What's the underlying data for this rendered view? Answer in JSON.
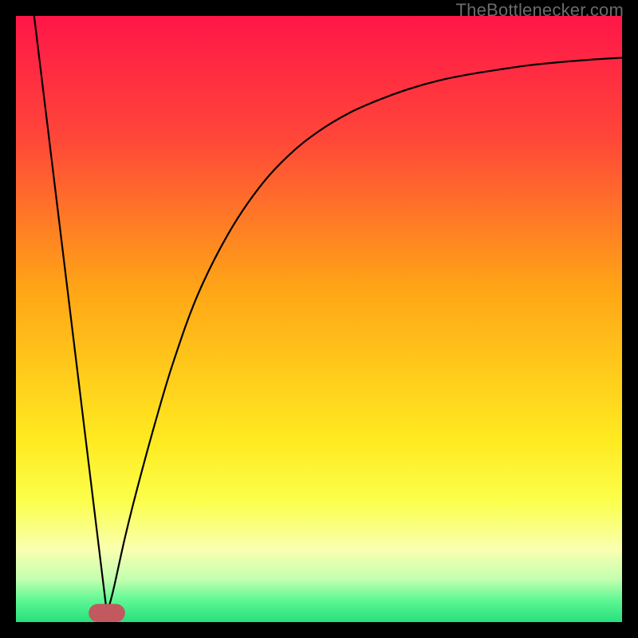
{
  "watermark": "TheBottlenecker.com",
  "chart_data": {
    "type": "line",
    "title": "",
    "xlabel": "",
    "ylabel": "",
    "xlim": [
      0,
      100
    ],
    "ylim": [
      0,
      100
    ],
    "gradient_stops": [
      {
        "offset": 0.0,
        "color": "#ff1648"
      },
      {
        "offset": 0.2,
        "color": "#ff4639"
      },
      {
        "offset": 0.45,
        "color": "#ffa516"
      },
      {
        "offset": 0.7,
        "color": "#ffea20"
      },
      {
        "offset": 0.8,
        "color": "#fbff4b"
      },
      {
        "offset": 0.88,
        "color": "#faffb0"
      },
      {
        "offset": 0.93,
        "color": "#c2ffb0"
      },
      {
        "offset": 0.965,
        "color": "#5cf793"
      },
      {
        "offset": 1.0,
        "color": "#26e07c"
      }
    ],
    "marker": {
      "x": 15,
      "y": 1.5,
      "w": 6,
      "h": 3,
      "rx": 1.5,
      "color": "#c1595e"
    },
    "series": [
      {
        "name": "left-v",
        "type": "line",
        "points": [
          {
            "x": 3.0,
            "y": 100.0
          },
          {
            "x": 15.0,
            "y": 1.5
          }
        ]
      },
      {
        "name": "right-curve",
        "type": "line",
        "points": [
          {
            "x": 15.0,
            "y": 1.5
          },
          {
            "x": 16.0,
            "y": 5.0
          },
          {
            "x": 18.0,
            "y": 14.0
          },
          {
            "x": 20.0,
            "y": 22.0
          },
          {
            "x": 23.0,
            "y": 33.0
          },
          {
            "x": 26.0,
            "y": 43.0
          },
          {
            "x": 30.0,
            "y": 54.0
          },
          {
            "x": 35.0,
            "y": 64.0
          },
          {
            "x": 40.0,
            "y": 71.5
          },
          {
            "x": 45.0,
            "y": 77.0
          },
          {
            "x": 50.0,
            "y": 81.0
          },
          {
            "x": 55.0,
            "y": 84.0
          },
          {
            "x": 60.0,
            "y": 86.2
          },
          {
            "x": 65.0,
            "y": 88.0
          },
          {
            "x": 70.0,
            "y": 89.4
          },
          {
            "x": 75.0,
            "y": 90.4
          },
          {
            "x": 80.0,
            "y": 91.2
          },
          {
            "x": 85.0,
            "y": 91.9
          },
          {
            "x": 90.0,
            "y": 92.4
          },
          {
            "x": 95.0,
            "y": 92.8
          },
          {
            "x": 100.0,
            "y": 93.1
          }
        ]
      }
    ]
  }
}
